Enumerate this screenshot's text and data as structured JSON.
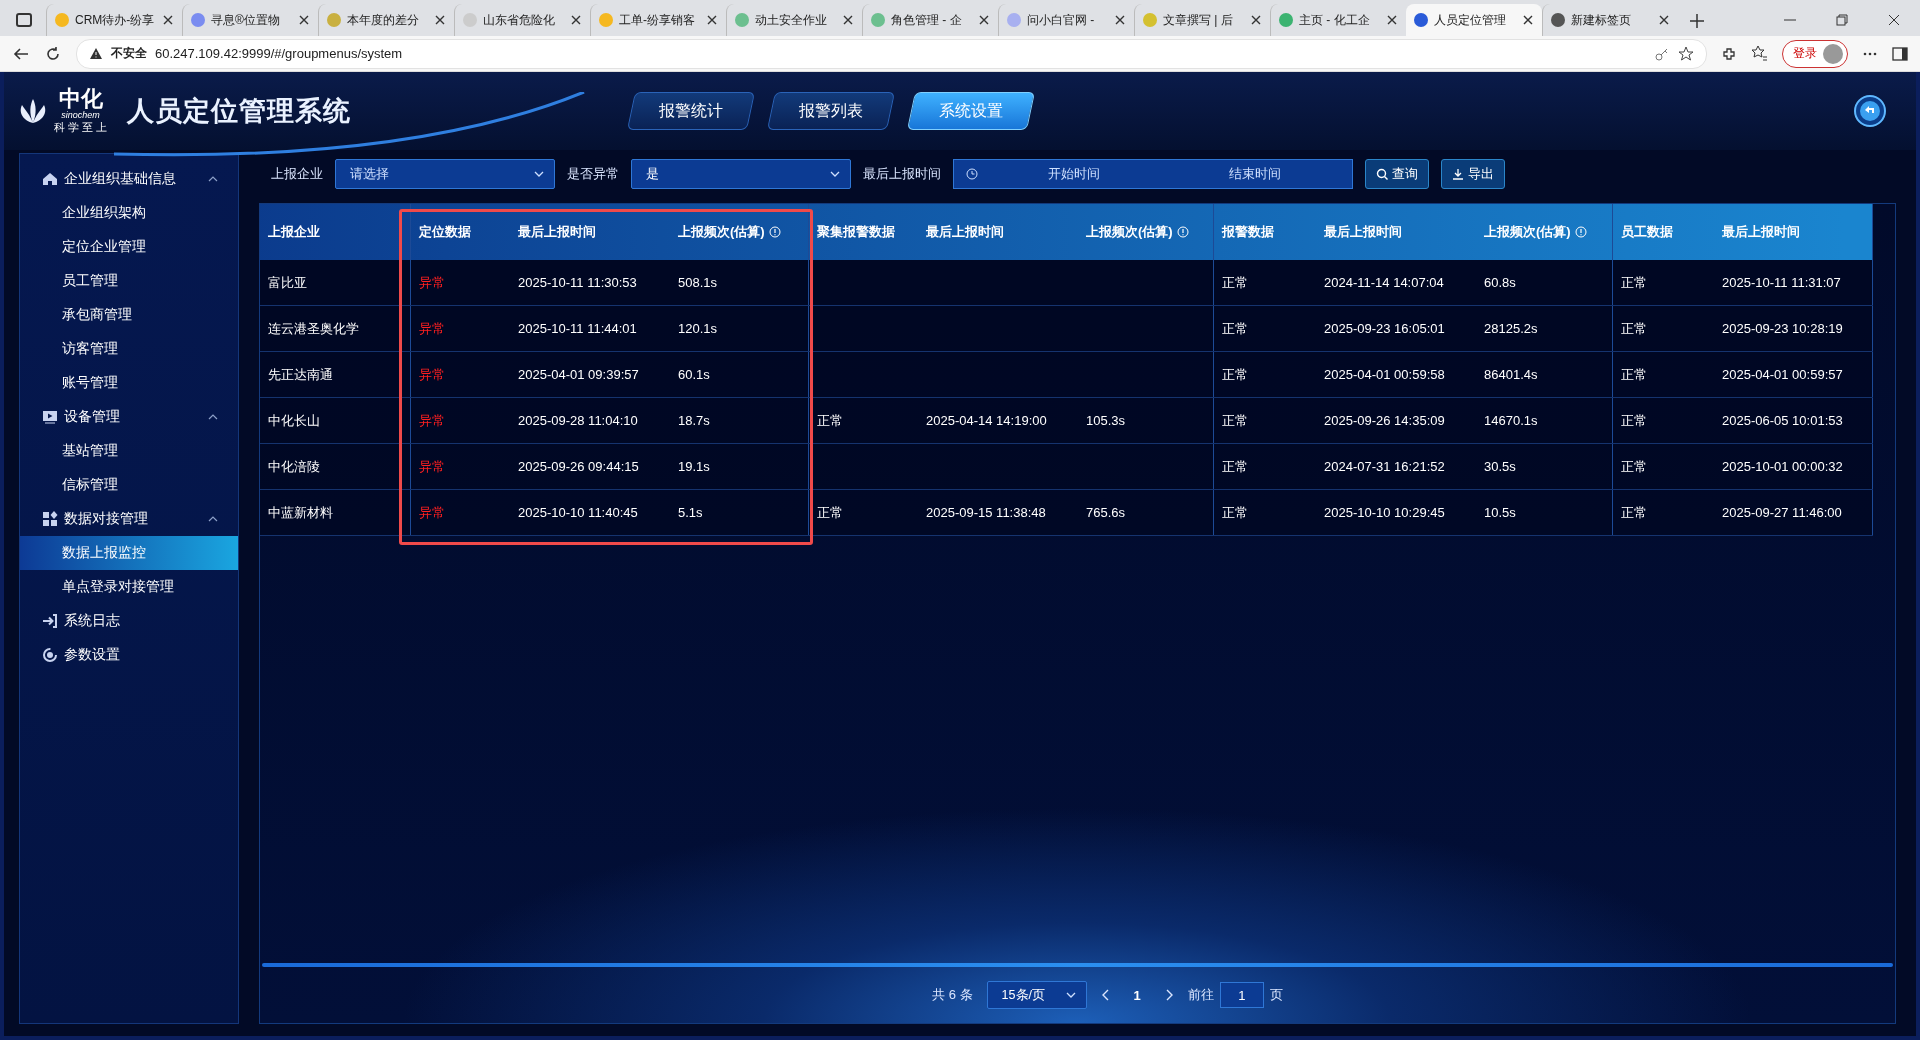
{
  "browser": {
    "tabs": [
      {
        "title": "CRM待办-纷享",
        "selected": false
      },
      {
        "title": "寻息®位置物",
        "selected": false
      },
      {
        "title": "本年度的差分",
        "selected": false
      },
      {
        "title": "山东省危险化",
        "selected": false
      },
      {
        "title": "工单-纷享销客",
        "selected": false
      },
      {
        "title": "动土安全作业",
        "selected": false
      },
      {
        "title": "角色管理 - 企",
        "selected": false
      },
      {
        "title": "问小白官网 - ",
        "selected": false
      },
      {
        "title": "文章撰写 | 后",
        "selected": false
      },
      {
        "title": "主页 - 化工企",
        "selected": false
      },
      {
        "title": "人员定位管理",
        "selected": true
      },
      {
        "title": "新建标签页",
        "selected": false
      }
    ],
    "security": "不安全",
    "url": "60.247.109.42:9999/#/groupmenus/system",
    "login": "登录"
  },
  "header": {
    "logo_name": "中化",
    "logo_sub": "sinochem",
    "logo_motto": "科 学 至 上",
    "title": "人员定位管理系统",
    "nav": [
      {
        "label": "报警统计",
        "selected": false
      },
      {
        "label": "报警列表",
        "selected": false
      },
      {
        "label": "系统设置",
        "selected": true
      }
    ]
  },
  "sidebar": {
    "items": [
      {
        "label": "企业组织基础信息",
        "expanded": true,
        "children": [
          {
            "label": "企业组织架构",
            "selected": false
          },
          {
            "label": "定位企业管理",
            "selected": false
          },
          {
            "label": "员工管理",
            "selected": false
          },
          {
            "label": "承包商管理",
            "selected": false
          },
          {
            "label": "访客管理",
            "selected": false
          },
          {
            "label": "账号管理",
            "selected": false
          }
        ]
      },
      {
        "label": "设备管理",
        "expanded": true,
        "children": [
          {
            "label": "基站管理",
            "selected": false
          },
          {
            "label": "信标管理",
            "selected": false
          }
        ]
      },
      {
        "label": "数据对接管理",
        "expanded": true,
        "children": [
          {
            "label": "数据上报监控",
            "selected": true
          },
          {
            "label": "单点登录对接管理",
            "selected": false
          }
        ]
      },
      {
        "label": "系统日志"
      },
      {
        "label": "参数设置"
      }
    ]
  },
  "filters": {
    "company": {
      "label": "上报企业",
      "placeholder": "请选择"
    },
    "abnormal": {
      "label": "是否异常",
      "value": "是"
    },
    "time": {
      "label": "最后上报时间",
      "start_placeholder": "开始时间",
      "end_placeholder": "结束时间"
    },
    "buttons": [
      "查询",
      "导出"
    ]
  },
  "table": {
    "groups": [
      {
        "highlighted": false,
        "columns": [
          {
            "title": "上报企业",
            "info": false
          }
        ]
      },
      {
        "highlighted": true,
        "columns": [
          {
            "title": "定位数据",
            "info": false
          },
          {
            "title": "最后上报时间",
            "info": false
          },
          {
            "title": "上报频次(估算)",
            "info": true
          }
        ]
      },
      {
        "highlighted": false,
        "columns": [
          {
            "title": "聚集报警数据",
            "info": false
          },
          {
            "title": "最后上报时间",
            "info": false
          },
          {
            "title": "上报频次(估算)",
            "info": true
          }
        ]
      },
      {
        "highlighted": false,
        "columns": [
          {
            "title": "报警数据",
            "info": false
          },
          {
            "title": "最后上报时间",
            "info": false
          },
          {
            "title": "上报频次(估算)",
            "info": true
          }
        ]
      },
      {
        "highlighted": false,
        "columns": [
          {
            "title": "员工数据",
            "info": false
          },
          {
            "title": "最后上报时间",
            "info": false
          }
        ]
      }
    ],
    "rows": [
      {
        "cells": [
          "富比亚",
          {
            "text": "异常",
            "alert": true
          },
          "2025-10-11 11:30:53",
          "508.1s",
          null,
          null,
          null,
          {
            "text": "正常",
            "alert": false
          },
          "2024-11-14 14:07:04",
          "60.8s",
          {
            "text": "正常",
            "alert": false
          },
          "2025-10-11 11:31:07"
        ]
      },
      {
        "cells": [
          "连云港圣奥化学",
          {
            "text": "异常",
            "alert": true
          },
          "2025-10-11 11:44:01",
          "120.1s",
          null,
          null,
          null,
          {
            "text": "正常",
            "alert": false
          },
          "2025-09-23 16:05:01",
          "28125.2s",
          {
            "text": "正常",
            "alert": false
          },
          "2025-09-23 10:28:19"
        ]
      },
      {
        "cells": [
          "先正达南通",
          {
            "text": "异常",
            "alert": true
          },
          "2025-04-01 09:39:57",
          "60.1s",
          null,
          null,
          null,
          {
            "text": "正常",
            "alert": false
          },
          "2025-04-01 00:59:58",
          "86401.4s",
          {
            "text": "正常",
            "alert": false
          },
          "2025-04-01 00:59:57"
        ]
      },
      {
        "cells": [
          "中化长山",
          {
            "text": "异常",
            "alert": true
          },
          "2025-09-28 11:04:10",
          "18.7s",
          {
            "text": "正常",
            "alert": false
          },
          "2025-04-14 14:19:00",
          "105.3s",
          {
            "text": "正常",
            "alert": false
          },
          "2025-09-26 14:35:09",
          "14670.1s",
          {
            "text": "正常",
            "alert": false
          },
          "2025-06-05 10:01:53"
        ]
      },
      {
        "cells": [
          "中化涪陵",
          {
            "text": "异常",
            "alert": true
          },
          "2025-09-26 09:44:15",
          "19.1s",
          null,
          null,
          null,
          {
            "text": "正常",
            "alert": false
          },
          "2024-07-31 16:21:52",
          "30.5s",
          {
            "text": "正常",
            "alert": false
          },
          "2025-10-01 00:00:32"
        ]
      },
      {
        "cells": [
          "中蓝新材料",
          {
            "text": "异常",
            "alert": true
          },
          "2025-10-10 11:40:45",
          "5.1s",
          {
            "text": "正常",
            "alert": false
          },
          "2025-09-15 11:38:48",
          "765.6s",
          {
            "text": "正常",
            "alert": false
          },
          "2025-10-10 10:29:45",
          "10.5s",
          {
            "text": "正常",
            "alert": false
          },
          "2025-09-27 11:46:00"
        ]
      }
    ]
  },
  "pagination": {
    "total": "共 6 条",
    "page_size": "15条/页",
    "current": "1",
    "goto_label": "前往",
    "goto_value": "1",
    "page_suffix": "页"
  }
}
